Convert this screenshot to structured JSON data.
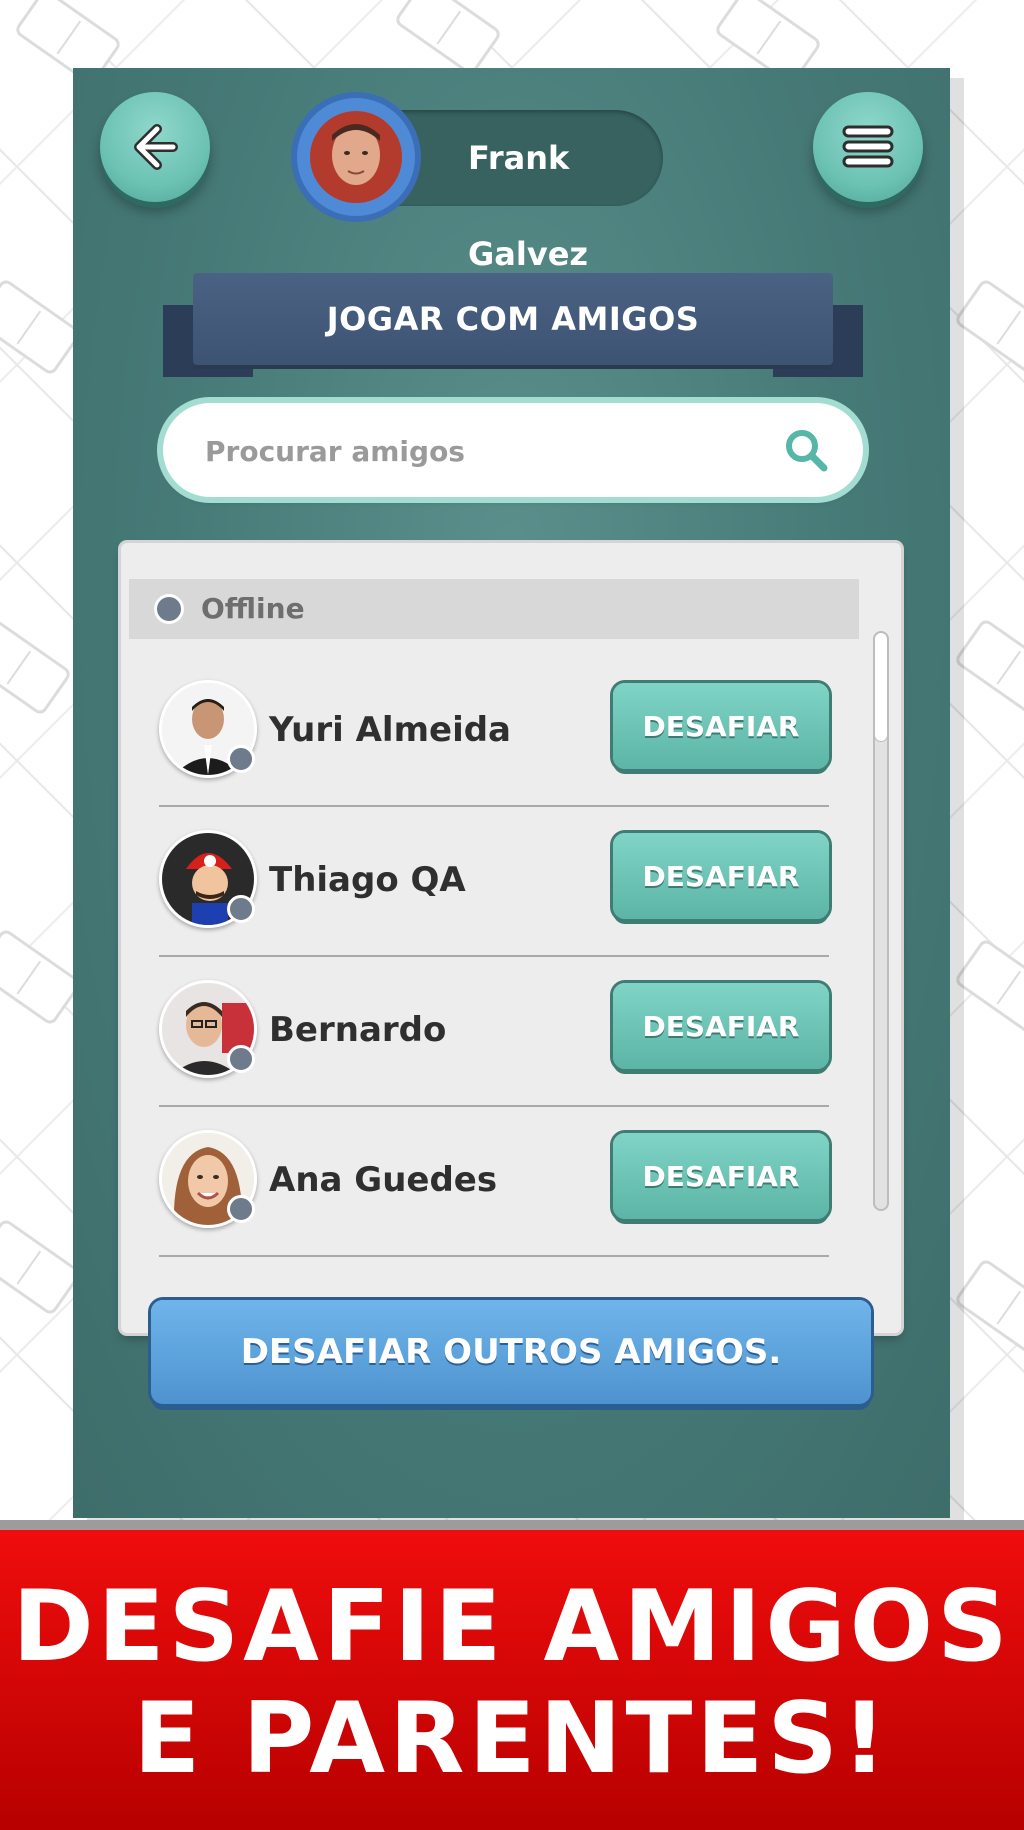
{
  "header": {
    "profile_name": "Frank Galvez"
  },
  "title": "JOGAR COM AMIGOS",
  "search": {
    "placeholder": "Procurar amigos",
    "value": ""
  },
  "friends_section": {
    "status_label": "Offline",
    "friends": [
      {
        "name": "Yuri Almeida",
        "action": "DESAFIAR"
      },
      {
        "name": "Thiago QA",
        "action": "DESAFIAR"
      },
      {
        "name": "Bernardo",
        "action": "DESAFIAR"
      },
      {
        "name": "Ana Guedes",
        "action": "DESAFIAR"
      }
    ]
  },
  "challenge_others_label": "DESAFIAR OUTROS AMIGOS.",
  "promo": {
    "line1": "DESAFIE AMIGOS",
    "line2": "E PARENTES!"
  },
  "colors": {
    "panel": "#467a77",
    "accent_teal": "#6cc2b3",
    "ribbon": "#3d5373",
    "blue_button": "#4e93cf",
    "banner_red": "#e00000",
    "offline_dot": "#6e7b8c"
  },
  "icons": [
    "back-arrow-icon",
    "menu-icon",
    "search-icon",
    "status-dot-icon"
  ]
}
